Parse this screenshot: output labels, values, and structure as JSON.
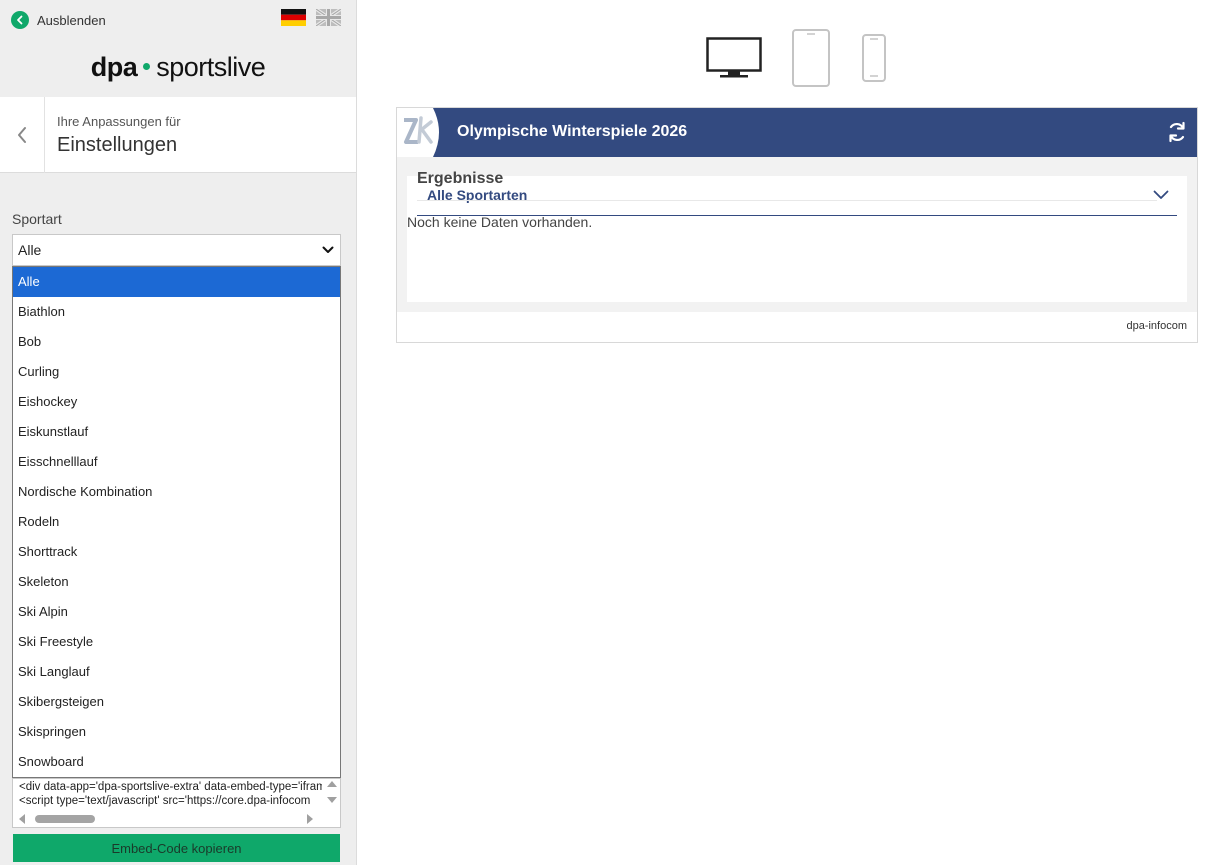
{
  "topbar": {
    "hide_label": "Ausblenden",
    "languages": [
      "de",
      "en"
    ]
  },
  "brand": {
    "part1": "dpa",
    "part2": "sportslive",
    "accent_color": "#0fa86a"
  },
  "settings": {
    "subtitle": "Ihre Anpassungen für",
    "title": "Einstellungen"
  },
  "sport_filter": {
    "label": "Sportart",
    "selected": "Alle",
    "options": [
      "Alle",
      "Biathlon",
      "Bob",
      "Curling",
      "Eishockey",
      "Eiskunstlauf",
      "Eisschnelllauf",
      "Nordische Kombination",
      "Rodeln",
      "Shorttrack",
      "Skeleton",
      "Ski Alpin",
      "Ski Freestyle",
      "Ski Langlauf",
      "Skibergsteigen",
      "Skispringen",
      "Snowboard"
    ]
  },
  "embed": {
    "line1": "<div data-app='dpa-sportslive-extra' data-embed-type='iframe'",
    "line2": "<script type='text/javascript' src='https://core.dpa-infocom",
    "copy_label": "Embed-Code kopieren"
  },
  "devices": [
    "desktop-icon",
    "tablet-icon",
    "phone-icon"
  ],
  "widget": {
    "title": "Olympische Winterspiele 2026",
    "header_color": "#334a80",
    "filter_label": "Alle Sportarten",
    "section_title": "Ergebnisse",
    "empty_text": "Noch keine Daten vorhanden.",
    "credit": "dpa-infocom"
  }
}
